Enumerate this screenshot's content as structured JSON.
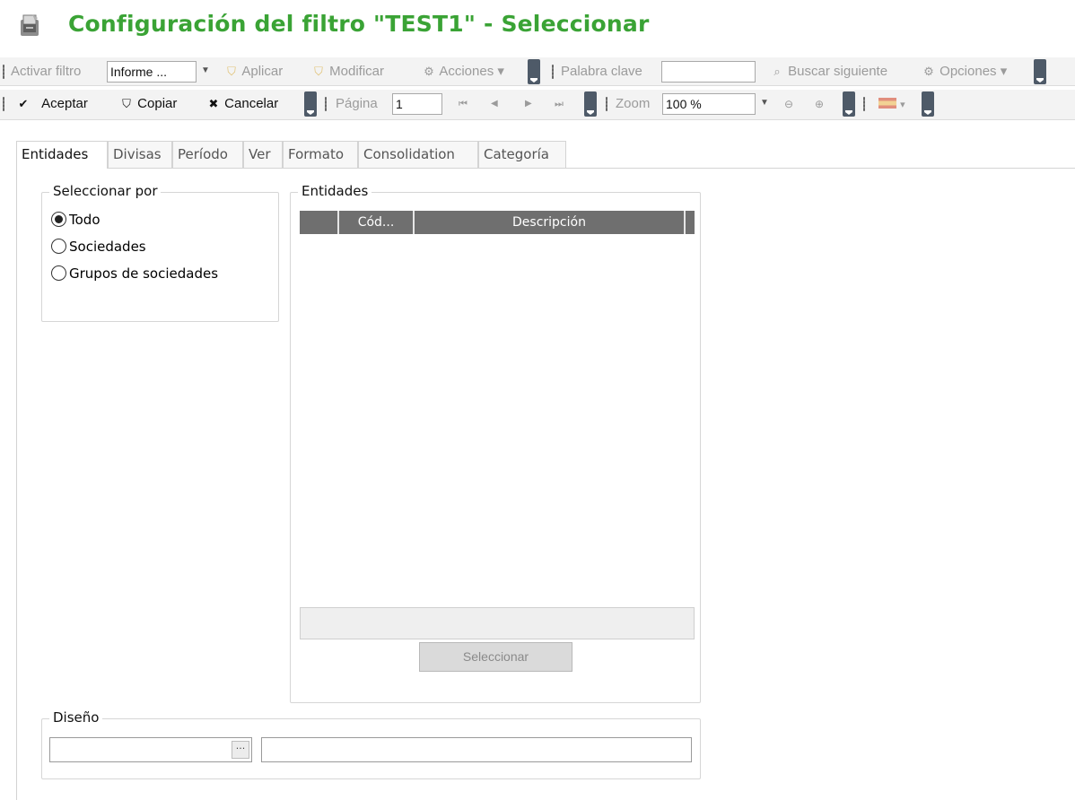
{
  "header": {
    "title": "Configuración del filtro \"TEST1\" - Seleccionar"
  },
  "toolbar1": {
    "activar_filtro": "Activar filtro",
    "informe_value": "Informe ...",
    "aplicar": "Aplicar",
    "modificar": "Modificar",
    "acciones": "Acciones",
    "palabra_clave": "Palabra clave",
    "palabra_clave_value": "",
    "buscar_siguiente": "Buscar siguiente",
    "opciones": "Opciones"
  },
  "toolbar2": {
    "aceptar": "Aceptar",
    "copiar": "Copiar",
    "cancelar": "Cancelar",
    "pagina": "Página",
    "pagina_value": "1",
    "zoom": "Zoom",
    "zoom_value": "100 %"
  },
  "tabs": [
    {
      "label": "Entidades"
    },
    {
      "label": "Divisas"
    },
    {
      "label": "Período"
    },
    {
      "label": "Ver"
    },
    {
      "label": "Formato"
    },
    {
      "label": "Consolidation"
    },
    {
      "label": "Categoría"
    }
  ],
  "seleccionar_por": {
    "title": "Seleccionar por",
    "options": [
      {
        "label": "Todo",
        "selected": true
      },
      {
        "label": "Sociedades",
        "selected": false
      },
      {
        "label": "Grupos de sociedades",
        "selected": false
      }
    ]
  },
  "entidades": {
    "title": "Entidades",
    "columns": [
      "Cód...",
      "Descripción"
    ],
    "select_button": "Seleccionar"
  },
  "diseno": {
    "title": "Diseño",
    "code_value": "",
    "description_value": ""
  },
  "colors": {
    "title_green": "#3aa335",
    "grid_header": "#6f6f6f",
    "toolbar_bg": "#f3f3f3"
  }
}
